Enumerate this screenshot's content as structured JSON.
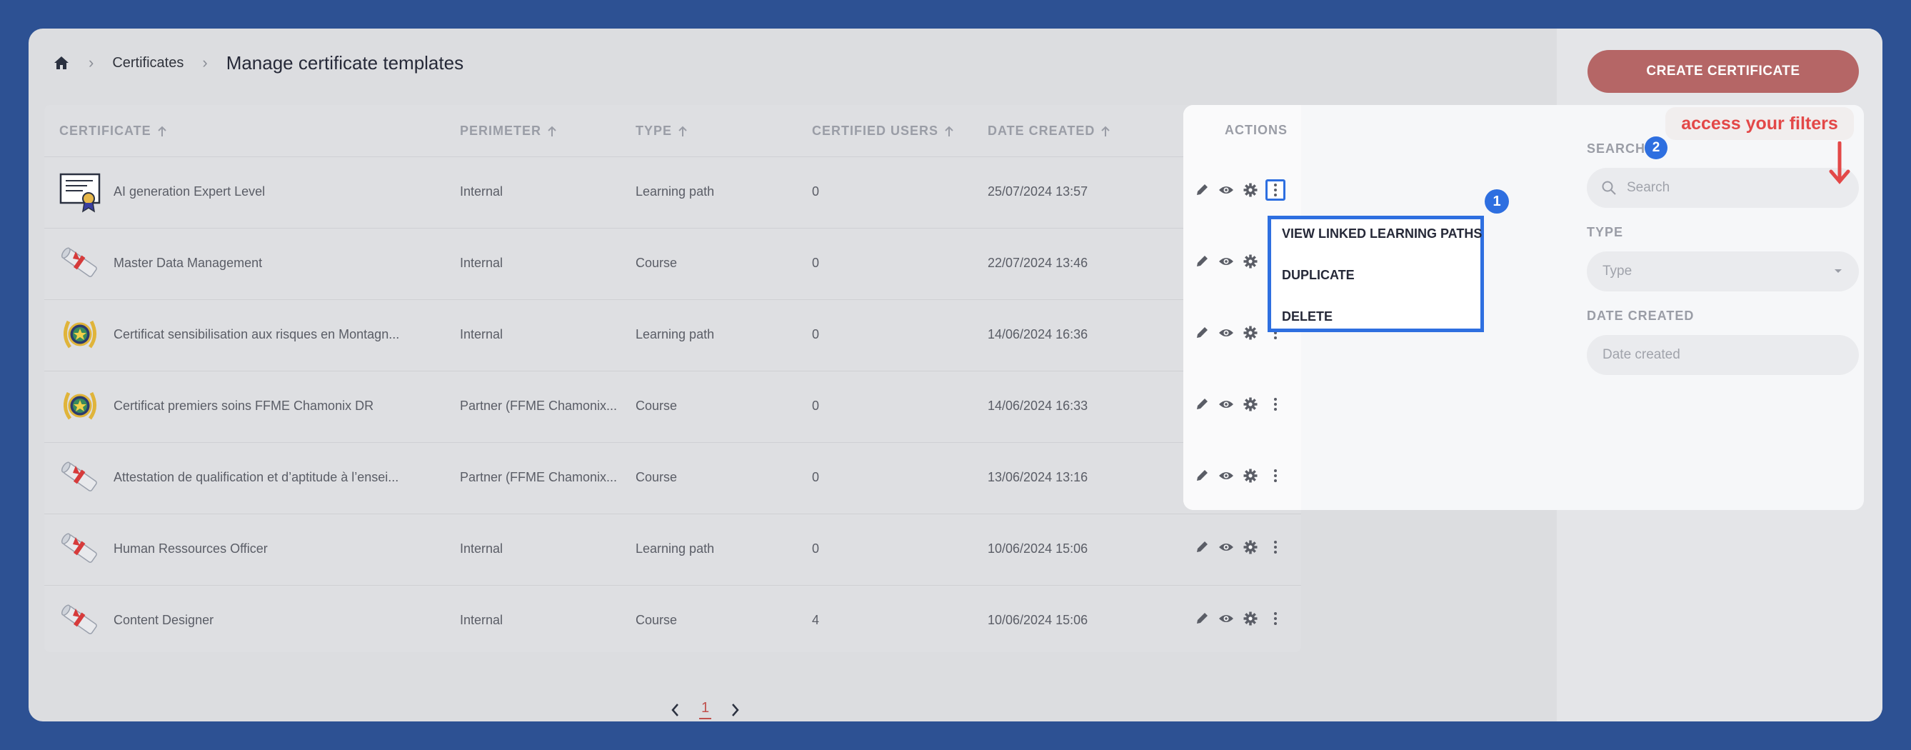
{
  "breadcrumb": {
    "home_icon": "home-icon",
    "crumb": "Certificates",
    "title": "Manage certificate templates"
  },
  "create_button": "CREATE CERTIFICATE",
  "table": {
    "columns": {
      "certificate": "CERTIFICATE",
      "perimeter": "PERIMETER",
      "type": "TYPE",
      "certified_users": "CERTIFIED USERS",
      "date_created": "DATE CREATED",
      "actions": "ACTIONS"
    },
    "rows": [
      {
        "icon": "diploma-frame-icon",
        "name": "AI generation Expert Level",
        "perimeter": "Internal",
        "type": "Learning path",
        "users": "0",
        "date": "25/07/2024 13:57"
      },
      {
        "icon": "diploma-scroll-icon",
        "name": "Master Data Management",
        "perimeter": "Internal",
        "type": "Course",
        "users": "0",
        "date": "22/07/2024 13:46"
      },
      {
        "icon": "laurel-medal-icon",
        "name": "Certificat sensibilisation aux risques en Montagn...",
        "perimeter": "Internal",
        "type": "Learning path",
        "users": "0",
        "date": "14/06/2024 16:36"
      },
      {
        "icon": "laurel-medal-icon",
        "name": "Certificat premiers soins FFME Chamonix DR",
        "perimeter": "Partner (FFME Chamonix...",
        "type": "Course",
        "users": "0",
        "date": "14/06/2024 16:33"
      },
      {
        "icon": "diploma-scroll-icon",
        "name": "Attestation de qualification et d’aptitude à l’ensei...",
        "perimeter": "Partner (FFME Chamonix...",
        "type": "Course",
        "users": "0",
        "date": "13/06/2024 13:16"
      },
      {
        "icon": "diploma-scroll-icon",
        "name": "Human Ressources Officer",
        "perimeter": "Internal",
        "type": "Learning path",
        "users": "0",
        "date": "10/06/2024 15:06"
      },
      {
        "icon": "diploma-scroll-icon",
        "name": "Content Designer",
        "perimeter": "Internal",
        "type": "Course",
        "users": "4",
        "date": "10/06/2024 15:06"
      }
    ],
    "row_action_icons": [
      "pencil-icon",
      "eye-icon",
      "gear-icon",
      "kebab-menu-icon"
    ]
  },
  "menu": {
    "items": [
      "VIEW LINKED LEARNING PATHS",
      "DUPLICATE",
      "DELETE"
    ],
    "badge": "1"
  },
  "filters": {
    "search_label": "SEARCH",
    "search_badge": "2",
    "search_placeholder": "Search",
    "type_label": "TYPE",
    "type_placeholder": "Type",
    "date_label": "DATE CREATED",
    "date_placeholder": "Date created",
    "note": "access your filters"
  },
  "pagination": {
    "current_page": "1"
  },
  "colors": {
    "accent_blue": "#2e6fe0",
    "create_button": "#b56666",
    "note_red": "#e34848",
    "background": "#2d5193"
  }
}
